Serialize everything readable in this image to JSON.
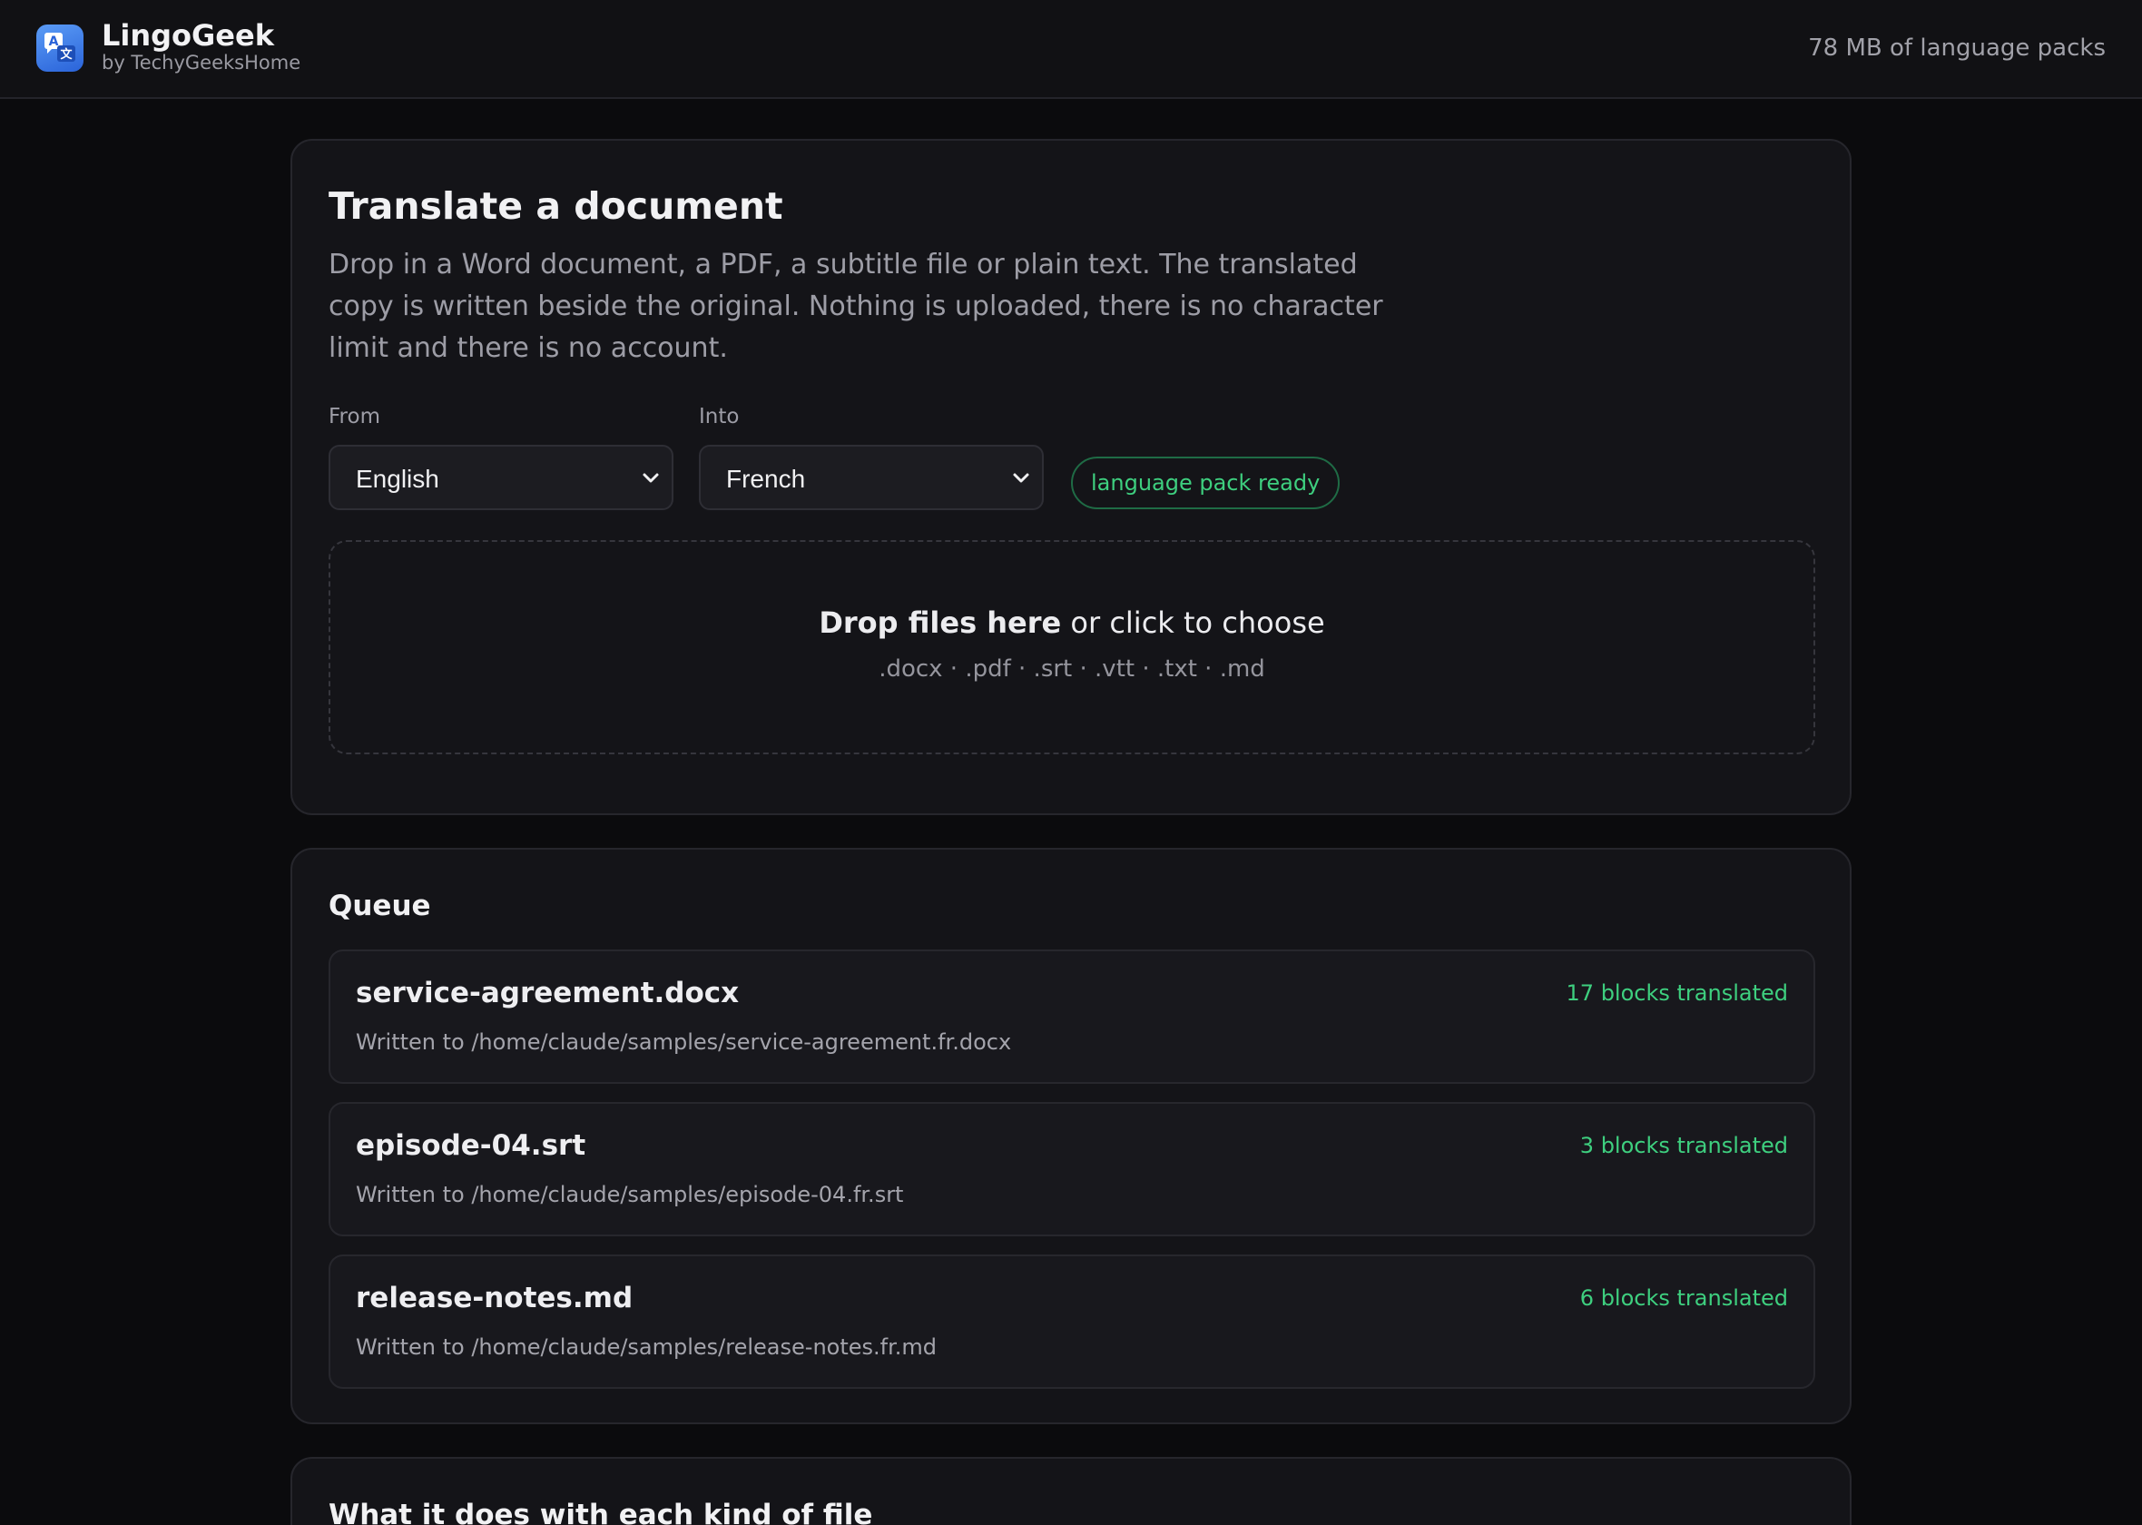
{
  "app": {
    "name": "LingoGeek",
    "byline": "by TechyGeeksHome",
    "storage": "78 MB of language packs",
    "accent": "#2a63d9"
  },
  "translate": {
    "title": "Translate a document",
    "description": "Drop in a Word document, a PDF, a subtitle file or plain text. The translated copy is written beside the original. Nothing is uploaded, there is no character limit and there is no account.",
    "from_label": "From",
    "from_value": "English",
    "into_label": "Into",
    "into_value": "French",
    "pack_status": "language pack ready",
    "status_color": "#3ecf7f",
    "dropzone": {
      "bold": "Drop files here",
      "rest": " or click to choose",
      "types": ".docx · .pdf · .srt · .vtt · .txt · .md"
    }
  },
  "queue": {
    "title": "Queue",
    "items": [
      {
        "name": "service-agreement.docx",
        "path": "Written to /home/claude/samples/service-agreement.fr.docx",
        "status": "17 blocks translated"
      },
      {
        "name": "episode-04.srt",
        "path": "Written to /home/claude/samples/episode-04.fr.srt",
        "status": "3 blocks translated"
      },
      {
        "name": "release-notes.md",
        "path": "Written to /home/claude/samples/release-notes.fr.md",
        "status": "6 blocks translated"
      }
    ]
  },
  "filetypes": {
    "title": "What it does with each kind of file"
  },
  "icons": {
    "logo": "translate-icon",
    "select_chevron": "chevron-down-icon"
  }
}
